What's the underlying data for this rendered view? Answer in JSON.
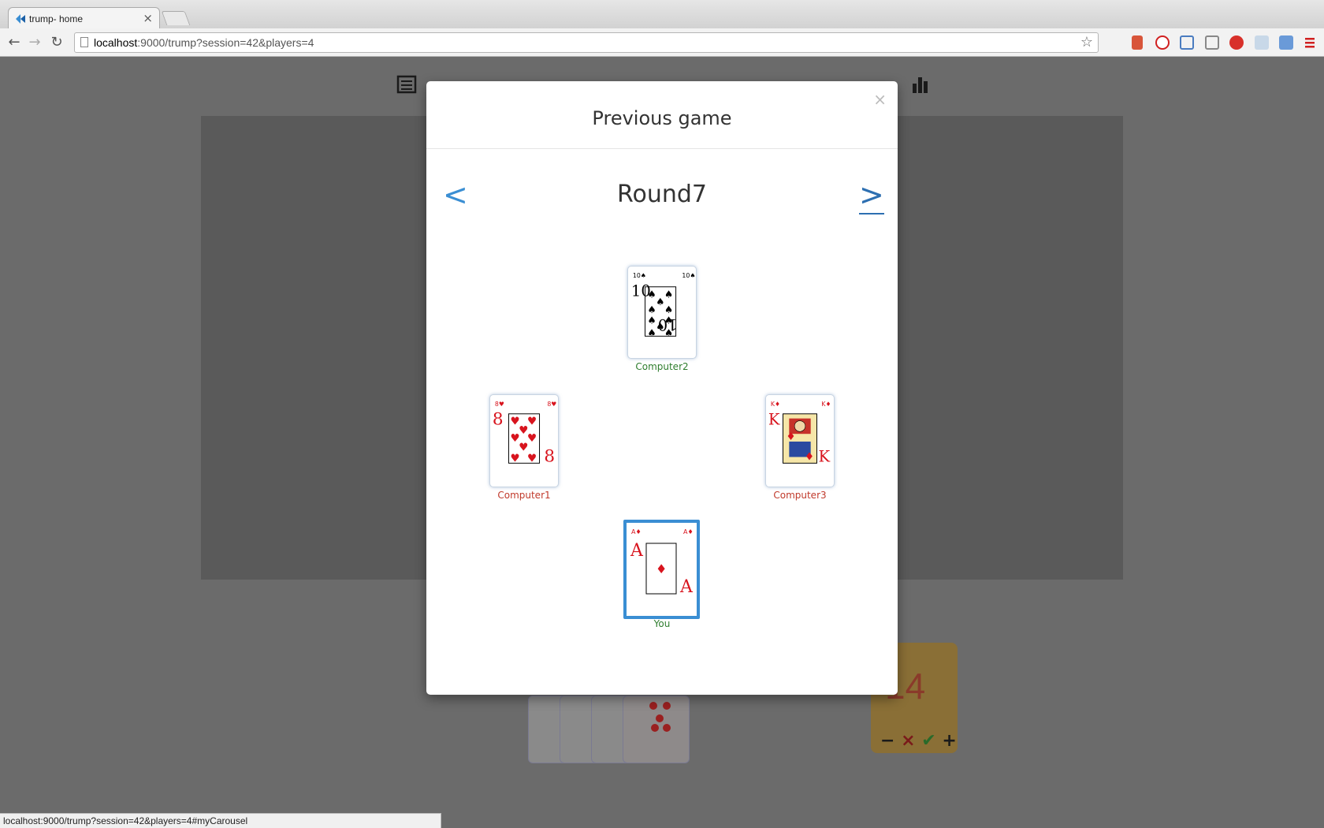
{
  "browser": {
    "tab_title": "trump- home",
    "tab_close": "×",
    "url_host": "localhost",
    "url_rest": ":9000/trump?session=42&players=4",
    "status_url": "localhost:9000/trump?session=42&players=4#myCarousel"
  },
  "background_page": {
    "bid_value": "14",
    "bid_controls": {
      "minus": "−",
      "cancel": "×",
      "confirm": "✔",
      "plus": "+"
    }
  },
  "modal": {
    "title": "Previous game",
    "close": "×",
    "prev": "<",
    "next": ">",
    "round": "Round7",
    "plays": {
      "top": {
        "player": "Computer2",
        "rank": "10",
        "suit": "spades",
        "color": "#000000",
        "name_color": "#2e7d2e"
      },
      "left": {
        "player": "Computer1",
        "rank": "8",
        "suit": "hearts",
        "color": "#d8141e",
        "name_color": "#c0392b"
      },
      "right": {
        "player": "Computer3",
        "rank": "K",
        "suit": "diamonds",
        "color": "#d8141e",
        "name_color": "#c0392b"
      },
      "bottom": {
        "player": "You",
        "rank": "A",
        "suit": "diamonds",
        "color": "#d8141e",
        "name_color": "#2e7d2e"
      }
    }
  },
  "colors": {
    "accent": "#3a8ed3",
    "overlay": "#777777"
  }
}
